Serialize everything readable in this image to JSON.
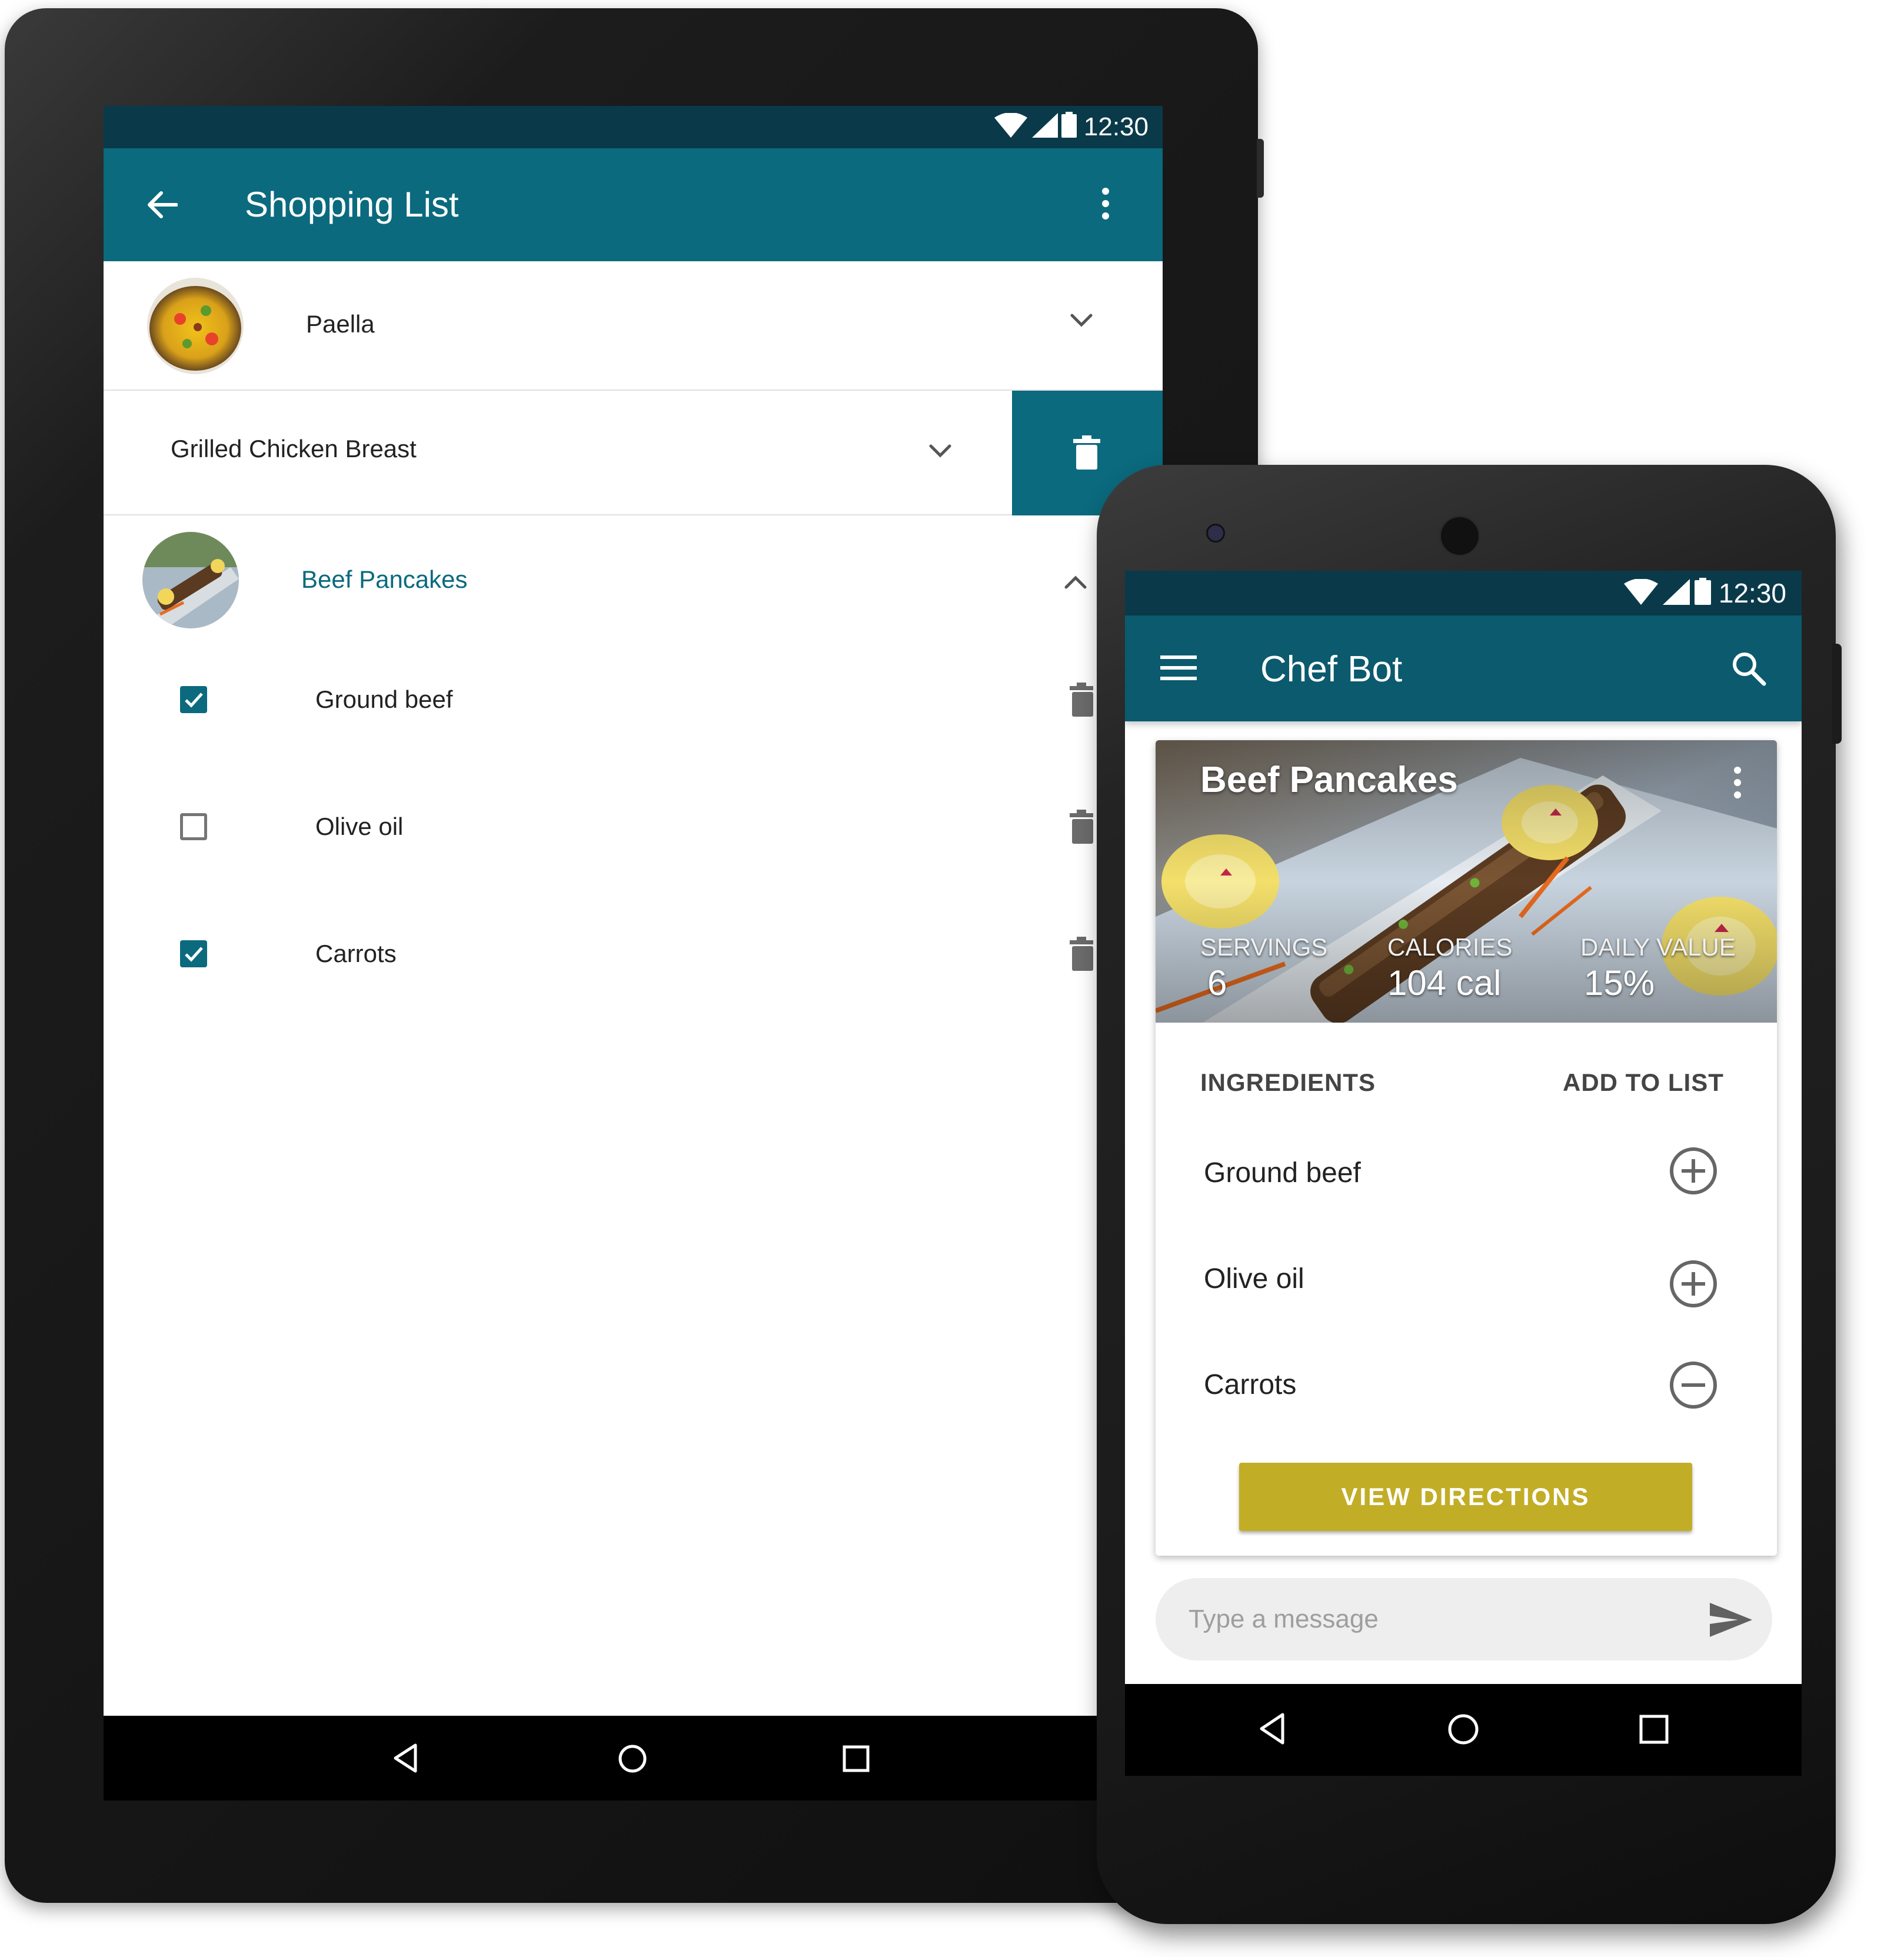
{
  "tablet": {
    "status_time": "12:30",
    "app_title": "Shopping List",
    "recipes": [
      {
        "name": "Paella",
        "expanded": false
      },
      {
        "name": "Grilled Chicken Breast",
        "expanded": false,
        "swiped_to_delete": true
      },
      {
        "name": "Beef Pancakes",
        "expanded": true
      }
    ],
    "ingredients": [
      {
        "name": "Ground beef",
        "checked": true
      },
      {
        "name": "Olive oil",
        "checked": false
      },
      {
        "name": "Carrots",
        "checked": true
      }
    ],
    "colors": {
      "primary": "#0b6a7e",
      "status_bar": "#0a3a4a",
      "accent_text": "#0b6a7e"
    }
  },
  "phone": {
    "status_time": "12:30",
    "app_title": "Chef Bot",
    "card": {
      "title": "Beef Pancakes",
      "stats": [
        {
          "label": "SERVINGS",
          "value": "6"
        },
        {
          "label": "CALORIES",
          "value": "104 cal"
        },
        {
          "label": "DAILY VALUE",
          "value": "15%"
        }
      ],
      "ingredients_header": "INGREDIENTS",
      "add_to_list_header": "ADD TO LIST",
      "ingredients": [
        {
          "name": "Ground beef",
          "action": "add"
        },
        {
          "name": "Olive oil",
          "action": "add"
        },
        {
          "name": "Carrots",
          "action": "remove"
        }
      ],
      "view_directions_label": "VIEW DIRECTIONS"
    },
    "message_placeholder": "Type a message",
    "colors": {
      "primary": "#0b5a6e",
      "button": "#c2ad26"
    }
  },
  "icons": [
    "wifi-icon",
    "cell-signal-icon",
    "battery-icon",
    "back-arrow-icon",
    "overflow-menu-icon",
    "chevron-down-icon",
    "chevron-up-icon",
    "trash-icon",
    "checkbox-icon",
    "hamburger-menu-icon",
    "search-icon",
    "add-circle-icon",
    "remove-circle-icon",
    "send-icon",
    "nav-back-icon",
    "nav-home-icon",
    "nav-recents-icon"
  ]
}
